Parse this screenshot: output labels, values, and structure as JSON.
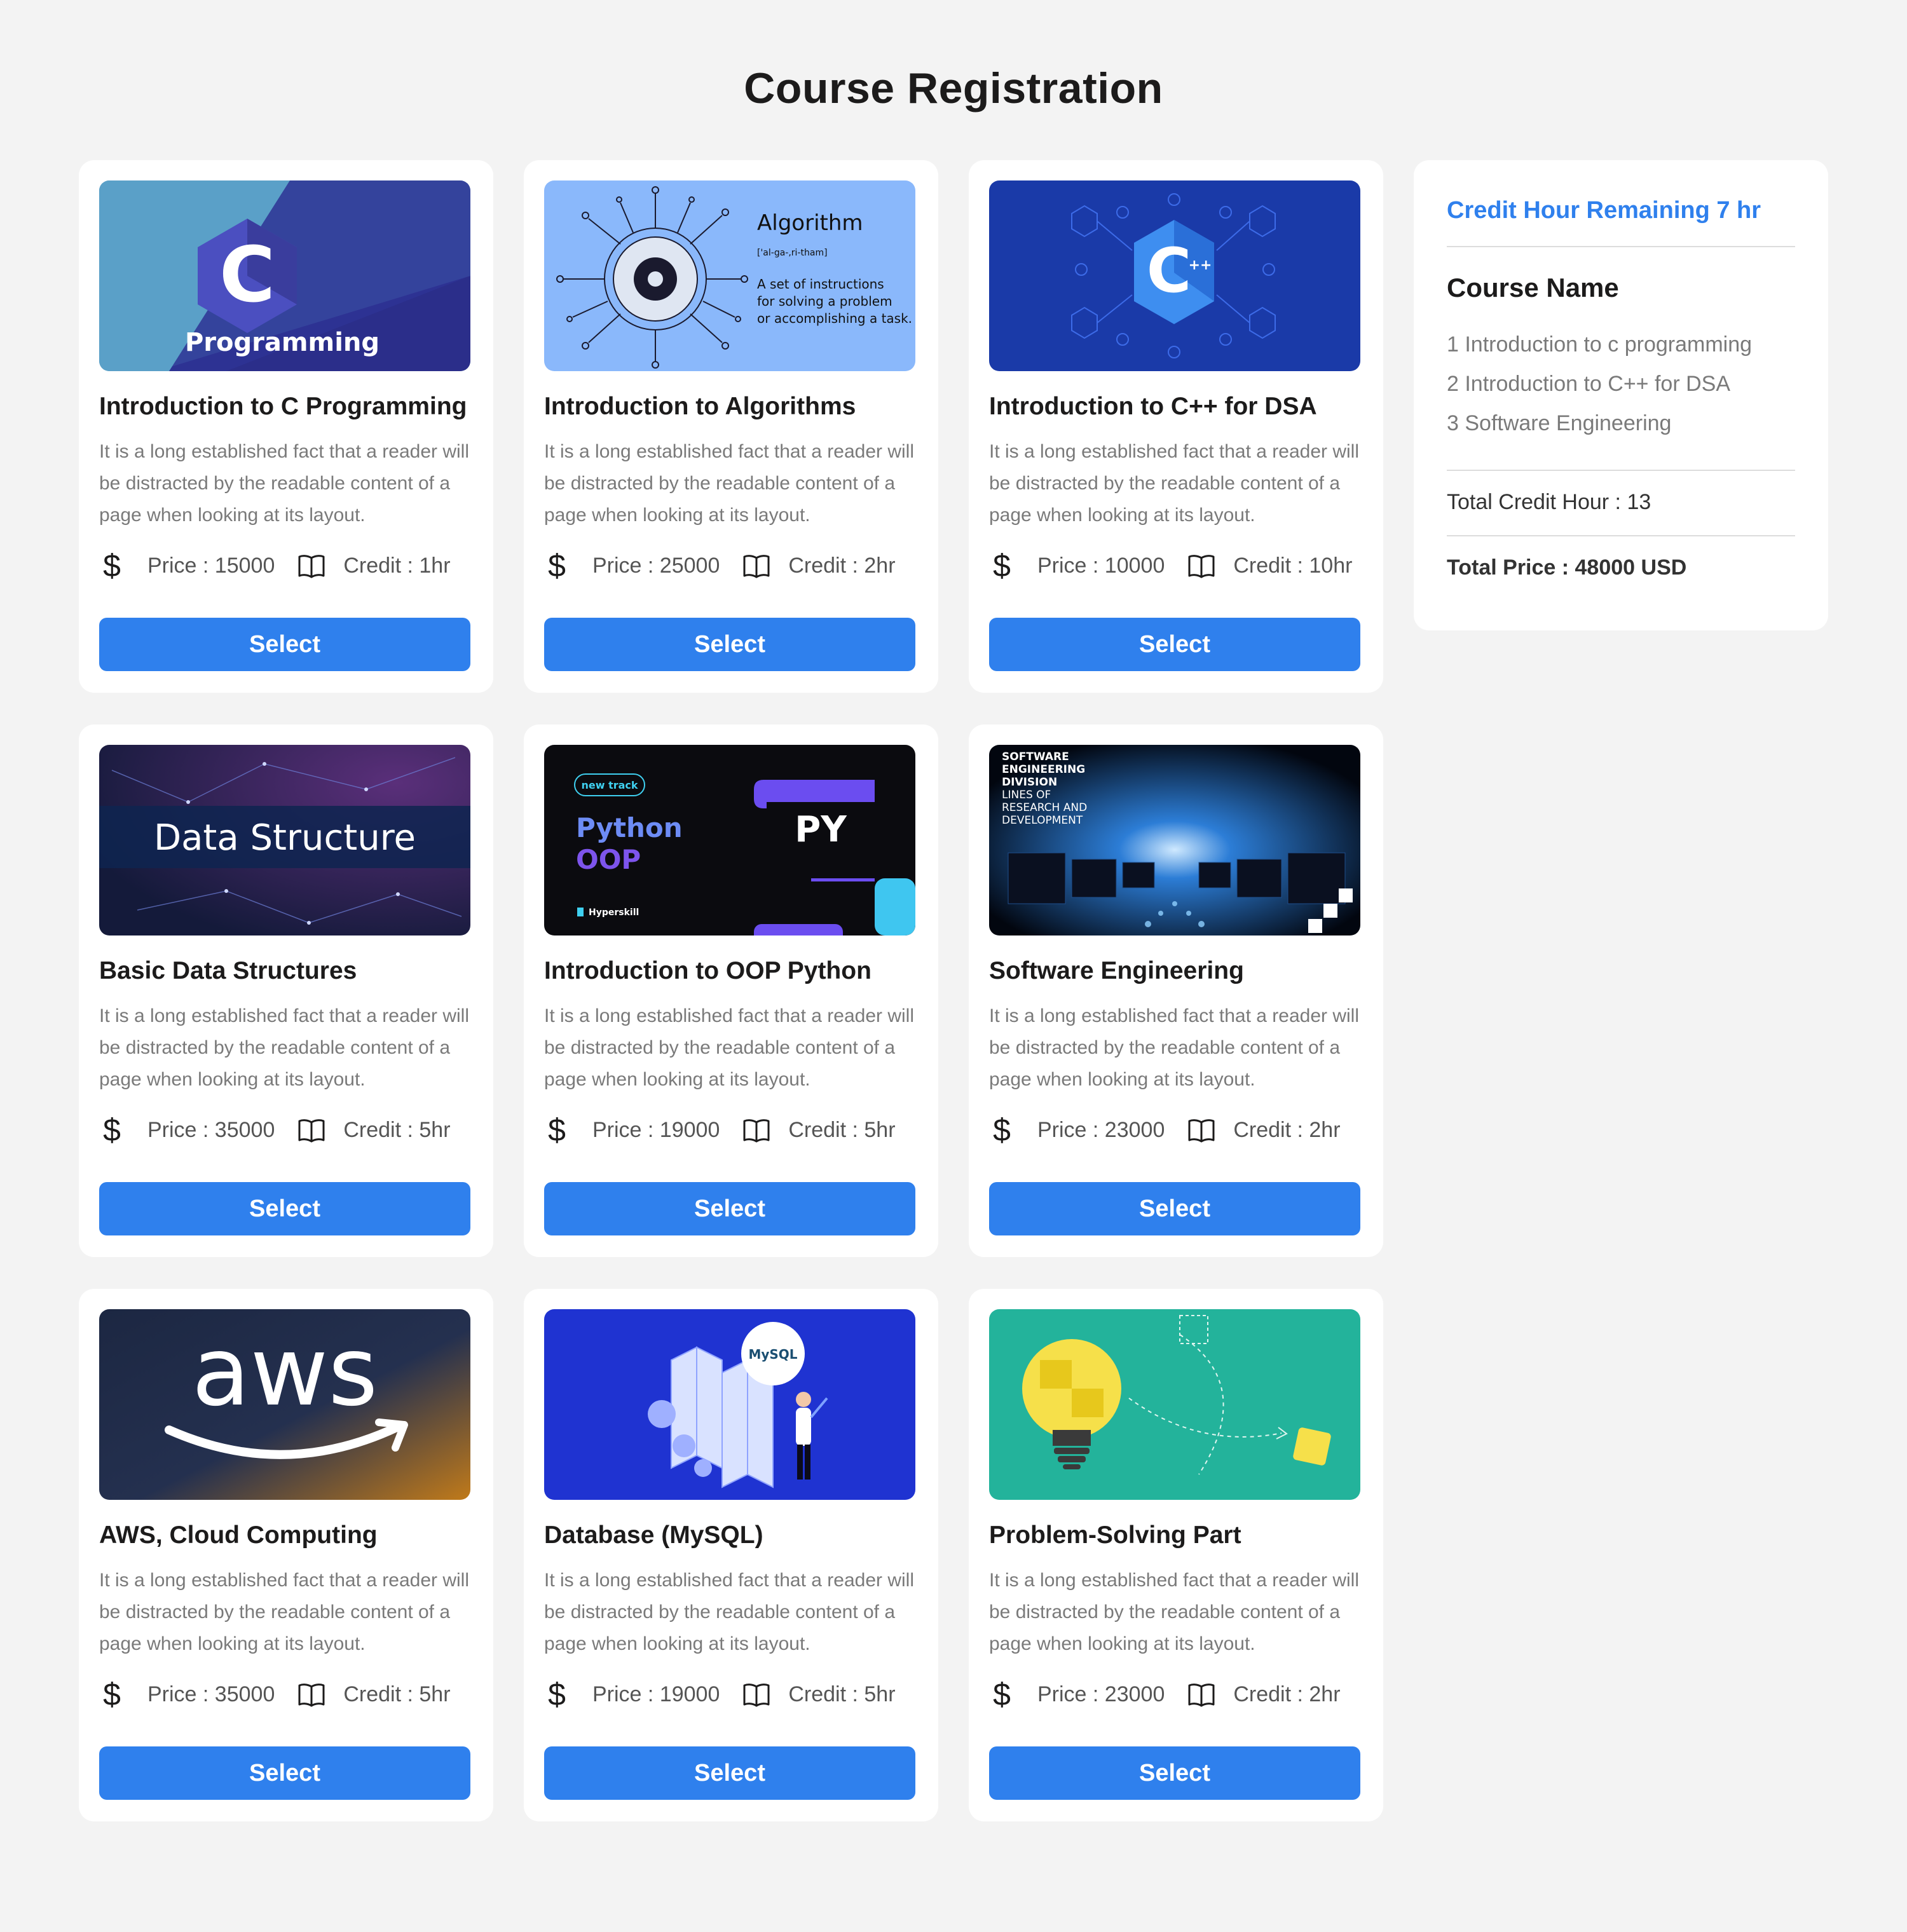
{
  "page": {
    "title": "Course Registration"
  },
  "courses": [
    {
      "title": "Introduction to C Programming",
      "description": "It is a long established fact that a reader will be distracted by the readable content of a page when looking at its layout.",
      "price": "Price : 15000",
      "credit": "Credit : 1hr",
      "select_label": "Select",
      "thumb_text": "Programming",
      "thumb_text_2": "C"
    },
    {
      "title": "Introduction to Algorithms",
      "description": "It is a long established fact that a reader will be distracted by the readable content of a page when looking at its layout.",
      "price": "Price : 25000",
      "credit": "Credit : 2hr",
      "select_label": "Select",
      "thumb_text": "Algorithm",
      "thumb_text_2": "['al-ga-,ri-tham]",
      "thumb_text_3": "A set of instructions",
      "thumb_text_4": "for solving a problem",
      "thumb_text_5": "or accomplishing a task."
    },
    {
      "title": "Introduction to C++ for DSA",
      "description": "It is a long established fact that a reader will be distracted by the readable content of a page when looking at its layout.",
      "price": "Price : 10000",
      "credit": "Credit : 10hr",
      "select_label": "Select",
      "thumb_text": "C",
      "thumb_text_2": "++"
    },
    {
      "title": "Basic Data Structures",
      "description": "It is a long established fact that a reader will be distracted by the readable content of a page when looking at its layout.",
      "price": "Price : 35000",
      "credit": "Credit : 5hr",
      "select_label": "Select",
      "thumb_text": "Data Structure"
    },
    {
      "title": "Introduction to OOP Python",
      "description": "It is a long established fact that a reader will be distracted by the readable content of a page when looking at its layout.",
      "price": "Price : 19000",
      "credit": "Credit : 5hr",
      "select_label": "Select",
      "thumb_text": "new track",
      "thumb_text_2": "Python",
      "thumb_text_3": "OOP",
      "thumb_text_4": "PY",
      "thumb_text_5": "Hyperskill"
    },
    {
      "title": "Software Engineering",
      "description": "It is a long established fact that a reader will be distracted by the readable content of a page when looking at its layout.",
      "price": "Price : 23000",
      "credit": "Credit : 2hr",
      "select_label": "Select",
      "thumb_text": "SOFTWARE",
      "thumb_text_2": "ENGINEERING",
      "thumb_text_3": "DIVISION",
      "thumb_text_4": "LINES OF",
      "thumb_text_5": "RESEARCH AND",
      "thumb_text_6": "DEVELOPMENT"
    },
    {
      "title": "AWS, Cloud Computing",
      "description": "It is a long established fact that a reader will be distracted by the readable content of a page when looking at its layout.",
      "price": "Price : 35000",
      "credit": "Credit : 5hr",
      "select_label": "Select",
      "thumb_text": "aws"
    },
    {
      "title": "Database (MySQL)",
      "description": "It is a long established fact that a reader will be distracted by the readable content of a page when looking at its layout.",
      "price": "Price : 19000",
      "credit": "Credit : 5hr",
      "select_label": "Select",
      "thumb_text": "MySQL"
    },
    {
      "title": "Problem-Solving Part",
      "description": "It is a long established fact that a reader will be distracted by the readable content of a page when looking at its layout.",
      "price": "Price : 23000",
      "credit": "Credit : 2hr",
      "select_label": "Select"
    }
  ],
  "summary": {
    "remaining": "Credit Hour Remaining 7 hr",
    "course_name_heading": "Course Name",
    "selected_courses": [
      "1 Introduction to c programming",
      "2 Introduction to C++ for DSA",
      "3 Software Engineering"
    ],
    "total_credit": "Total Credit Hour : 13",
    "total_price": "Total Price : 48000 USD"
  },
  "icons": {
    "price": "dollar-icon",
    "credit": "book-icon"
  },
  "colors": {
    "accent": "#2f80ed",
    "background": "#f3f3f3",
    "card": "#ffffff"
  }
}
